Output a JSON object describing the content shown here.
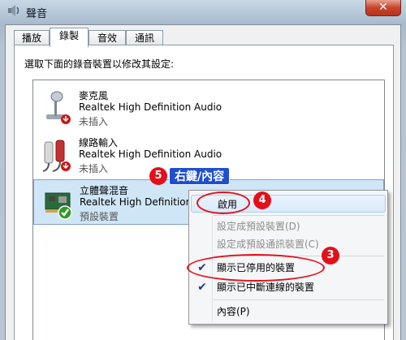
{
  "window": {
    "title": "聲音",
    "close_label": "✕"
  },
  "tabs": [
    {
      "label": "播放"
    },
    {
      "label": "錄製"
    },
    {
      "label": "音效"
    },
    {
      "label": "通訊"
    }
  ],
  "instruction": "選取下面的錄音裝置以修改其設定:",
  "devices": [
    {
      "name": "麥克風",
      "driver": "Realtek High Definition Audio",
      "status": "未插入"
    },
    {
      "name": "線路輸入",
      "driver": "Realtek High Definition Audio",
      "status": "未插入"
    },
    {
      "name": "立體聲混音",
      "driver": "Realtek High Definition",
      "status": "預設裝置"
    }
  ],
  "context_menu": {
    "items": [
      {
        "label": "啟用",
        "enabled": true,
        "checked": false
      },
      {
        "label": "設定成預設裝置(D)",
        "enabled": false,
        "checked": false
      },
      {
        "label": "設定成預設通訊裝置(C)",
        "enabled": false,
        "checked": false
      },
      {
        "label": "顯示已停用的裝置",
        "enabled": true,
        "checked": true
      },
      {
        "label": "顯示已中斷連線的裝置",
        "enabled": true,
        "checked": true
      },
      {
        "label": "內容(P)",
        "enabled": true,
        "checked": false
      }
    ]
  },
  "annotations": {
    "step3": "3",
    "step4": "4",
    "step5": "5",
    "callout_text": "右鍵/內容"
  },
  "colors": {
    "annotation_red": "#e3101a",
    "callout_blue": "#1d4fd0",
    "default_check_green": "#2e9a1e"
  }
}
